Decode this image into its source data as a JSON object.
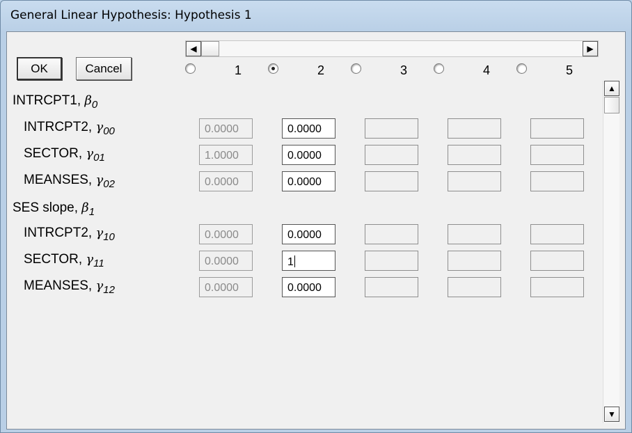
{
  "window": {
    "title": "General Linear Hypothesis: Hypothesis 1"
  },
  "buttons": {
    "ok": "OK",
    "cancel": "Cancel"
  },
  "scrollbar_icons": {
    "left": "arrow-left-icon",
    "right": "arrow-right-icon",
    "up": "arrow-up-icon",
    "down": "arrow-down-icon"
  },
  "columns": [
    {
      "label": "1",
      "selected": false
    },
    {
      "label": "2",
      "selected": true
    },
    {
      "label": "3",
      "selected": false
    },
    {
      "label": "4",
      "selected": false
    },
    {
      "label": "5",
      "selected": false
    }
  ],
  "sections": [
    {
      "label": "INTRCPT1, ",
      "greek": "β",
      "sub": "0",
      "rows": [
        {
          "label": "INTRCPT2, ",
          "greek": "γ",
          "sub": "00",
          "col1": "0.0000",
          "col2": "0.0000"
        },
        {
          "label": "SECTOR, ",
          "greek": "γ",
          "sub": "01",
          "col1": "1.0000",
          "col2": "0.0000"
        },
        {
          "label": "MEANSES, ",
          "greek": "γ",
          "sub": "02",
          "col1": "0.0000",
          "col2": "0.0000"
        }
      ]
    },
    {
      "label": "SES slope, ",
      "greek": "β",
      "sub": "1",
      "rows": [
        {
          "label": "INTRCPT2, ",
          "greek": "γ",
          "sub": "10",
          "col1": "0.0000",
          "col2": "0.0000"
        },
        {
          "label": "SECTOR, ",
          "greek": "γ",
          "sub": "11",
          "col1": "0.0000",
          "col2": "1"
        },
        {
          "label": "MEANSES, ",
          "greek": "γ",
          "sub": "12",
          "col1": "0.0000",
          "col2": "0.0000"
        }
      ]
    }
  ]
}
